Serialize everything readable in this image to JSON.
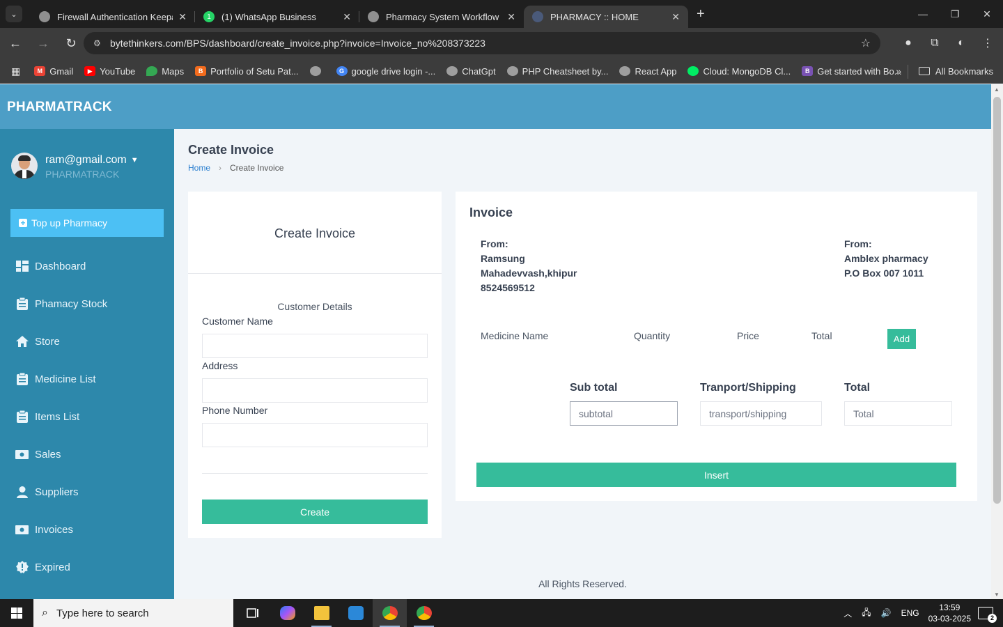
{
  "browser": {
    "tabs": [
      {
        "title": "Firewall Authentication Keepalive",
        "favicon_color": "#8f8f8f"
      },
      {
        "title": "(1) WhatsApp Business",
        "favicon_color": "#25d366"
      },
      {
        "title": "Pharmacy System Workflow",
        "favicon_color": "#8f8f8f"
      },
      {
        "title": "PHARMACY :: HOME",
        "favicon_color": "#4a5a7a"
      }
    ],
    "url": "bytethinkers.com/BPS/dashboard/create_invoice.php?invoice=Invoice_no%208373223",
    "bookmarks": [
      {
        "label": "Gmail",
        "color": "#ea4335"
      },
      {
        "label": "YouTube",
        "color": "#ff0000"
      },
      {
        "label": "Maps",
        "color": "#34a853"
      },
      {
        "label": "Portfolio of Setu Pat...",
        "color": "#f26b1d"
      },
      {
        "label": "",
        "color": "#9e9e9e"
      },
      {
        "label": "google drive login -...",
        "color": "#4285f4"
      },
      {
        "label": "ChatGpt",
        "color": "#9e9e9e"
      },
      {
        "label": "PHP Cheatsheet by...",
        "color": "#9e9e9e"
      },
      {
        "label": "React App",
        "color": "#9e9e9e"
      },
      {
        "label": "Cloud: MongoDB Cl...",
        "color": "#00ed64"
      },
      {
        "label": "Get started with Bo...",
        "color": "#7952b3"
      }
    ],
    "all_bookmarks": "All Bookmarks"
  },
  "app": {
    "brand": "PHARMATRACK",
    "user": {
      "email": "ram@gmail.com",
      "org": "PHARMATRACK"
    },
    "topup_label": "Top up Pharmacy",
    "menu": [
      {
        "label": "Dashboard",
        "icon": "dashboard-icon"
      },
      {
        "label": "Phamacy Stock",
        "icon": "clipboard-icon"
      },
      {
        "label": "Store",
        "icon": "home-icon"
      },
      {
        "label": "Medicine List",
        "icon": "clipboard-icon"
      },
      {
        "label": "Items List",
        "icon": "clipboard-icon"
      },
      {
        "label": "Sales",
        "icon": "money-icon"
      },
      {
        "label": "Suppliers",
        "icon": "user-icon"
      },
      {
        "label": "Invoices",
        "icon": "money-icon"
      },
      {
        "label": "Expired",
        "icon": "badge-icon"
      }
    ],
    "page_title": "Create Invoice",
    "breadcrumb": {
      "home": "Home",
      "current": "Create Invoice"
    },
    "create_card": {
      "title": "Create Invoice",
      "subtitle": "Customer Details",
      "customer_name_label": "Customer Name",
      "address_label": "Address",
      "phone_label": "Phone Number",
      "create_button": "Create"
    },
    "invoice": {
      "title": "Invoice",
      "from_left": {
        "heading": "From:",
        "name": "Ramsung",
        "address": "Mahadevvash,khipur",
        "phone": "8524569512"
      },
      "from_right": {
        "heading": "From:",
        "name": "Amblex pharmacy",
        "address": "P.O Box 007 1011"
      },
      "columns": [
        "Medicine Name",
        "Quantity",
        "Price",
        "Total"
      ],
      "add_button": "Add",
      "subtotal_label": "Sub total",
      "subtotal_placeholder": "subtotal",
      "shipping_label": "Tranport/Shipping",
      "shipping_placeholder": "transport/shipping",
      "total_label": "Total",
      "total_placeholder": "Total",
      "insert_button": "Insert"
    },
    "footer": "All Rights Reserved."
  },
  "taskbar": {
    "search_placeholder": "Type here to search",
    "language": "ENG",
    "time": "13:59",
    "date": "03-03-2025",
    "notifications": "2"
  },
  "colors": {
    "header": "#4d9ec6",
    "sidebar": "#2d88ab",
    "accent": "#36bc9b",
    "topup": "#4cc0f4"
  }
}
